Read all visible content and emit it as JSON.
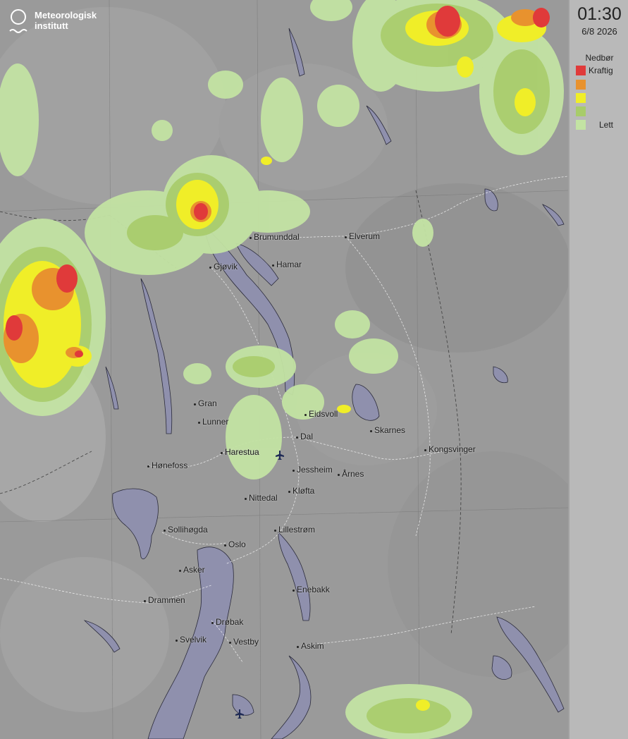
{
  "logo": {
    "line1": "Meteorologisk",
    "line2": "institutt"
  },
  "timestamp": {
    "time": "01:30",
    "date": "6/8 2026"
  },
  "legend": {
    "title": "Nedbør",
    "items": [
      {
        "label": "Kraftig",
        "color": "#e03a3a"
      },
      {
        "label": "",
        "color": "#e8922e"
      },
      {
        "label": "",
        "color": "#f0ee28"
      },
      {
        "label": "",
        "color": "#a8cc6a"
      },
      {
        "label": "Lett",
        "color": "#c3e3a3"
      }
    ]
  },
  "cities": [
    {
      "name": "Brumunddal"
    },
    {
      "name": "Elverum"
    },
    {
      "name": "Gjøvik"
    },
    {
      "name": "Hamar"
    },
    {
      "name": "Gran"
    },
    {
      "name": "Lunner"
    },
    {
      "name": "Eidsvoll"
    },
    {
      "name": "Dal"
    },
    {
      "name": "Skarnes"
    },
    {
      "name": "Kongsvinger"
    },
    {
      "name": "Harestua"
    },
    {
      "name": "Hønefoss"
    },
    {
      "name": "Jessheim"
    },
    {
      "name": "Årnes"
    },
    {
      "name": "Kløfta"
    },
    {
      "name": "Nittedal"
    },
    {
      "name": "Sollihøgda"
    },
    {
      "name": "Oslo"
    },
    {
      "name": "Lillestrøm"
    },
    {
      "name": "Asker"
    },
    {
      "name": "Enebakk"
    },
    {
      "name": "Drammen"
    },
    {
      "name": "Drøbak"
    },
    {
      "name": "Svelvik"
    },
    {
      "name": "Vestby"
    },
    {
      "name": "Askim"
    }
  ],
  "colors": {
    "water": "#8f90ad",
    "land": "#9b9b9b",
    "road": "#ffffff"
  }
}
